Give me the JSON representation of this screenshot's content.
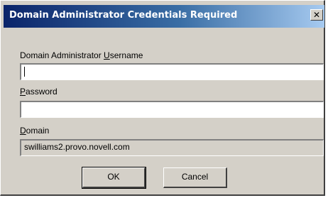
{
  "window": {
    "title": "Domain Administrator Credentials Required",
    "close_glyph": "✕"
  },
  "fields": {
    "username": {
      "label_pre": "Domain Administrator ",
      "label_mnemonic": "U",
      "label_post": "sername",
      "value": ""
    },
    "password": {
      "label_pre": "",
      "label_mnemonic": "P",
      "label_post": "assword",
      "value": ""
    },
    "domain": {
      "label_pre": "",
      "label_mnemonic": "D",
      "label_post": "omain",
      "value": "swilliams2.provo.novell.com"
    }
  },
  "buttons": {
    "ok_label": "OK",
    "cancel_label": "Cancel"
  },
  "colors": {
    "titlebar_start": "#0a246a",
    "titlebar_end": "#a6caf0",
    "dialog_face": "#d4d0c8"
  }
}
